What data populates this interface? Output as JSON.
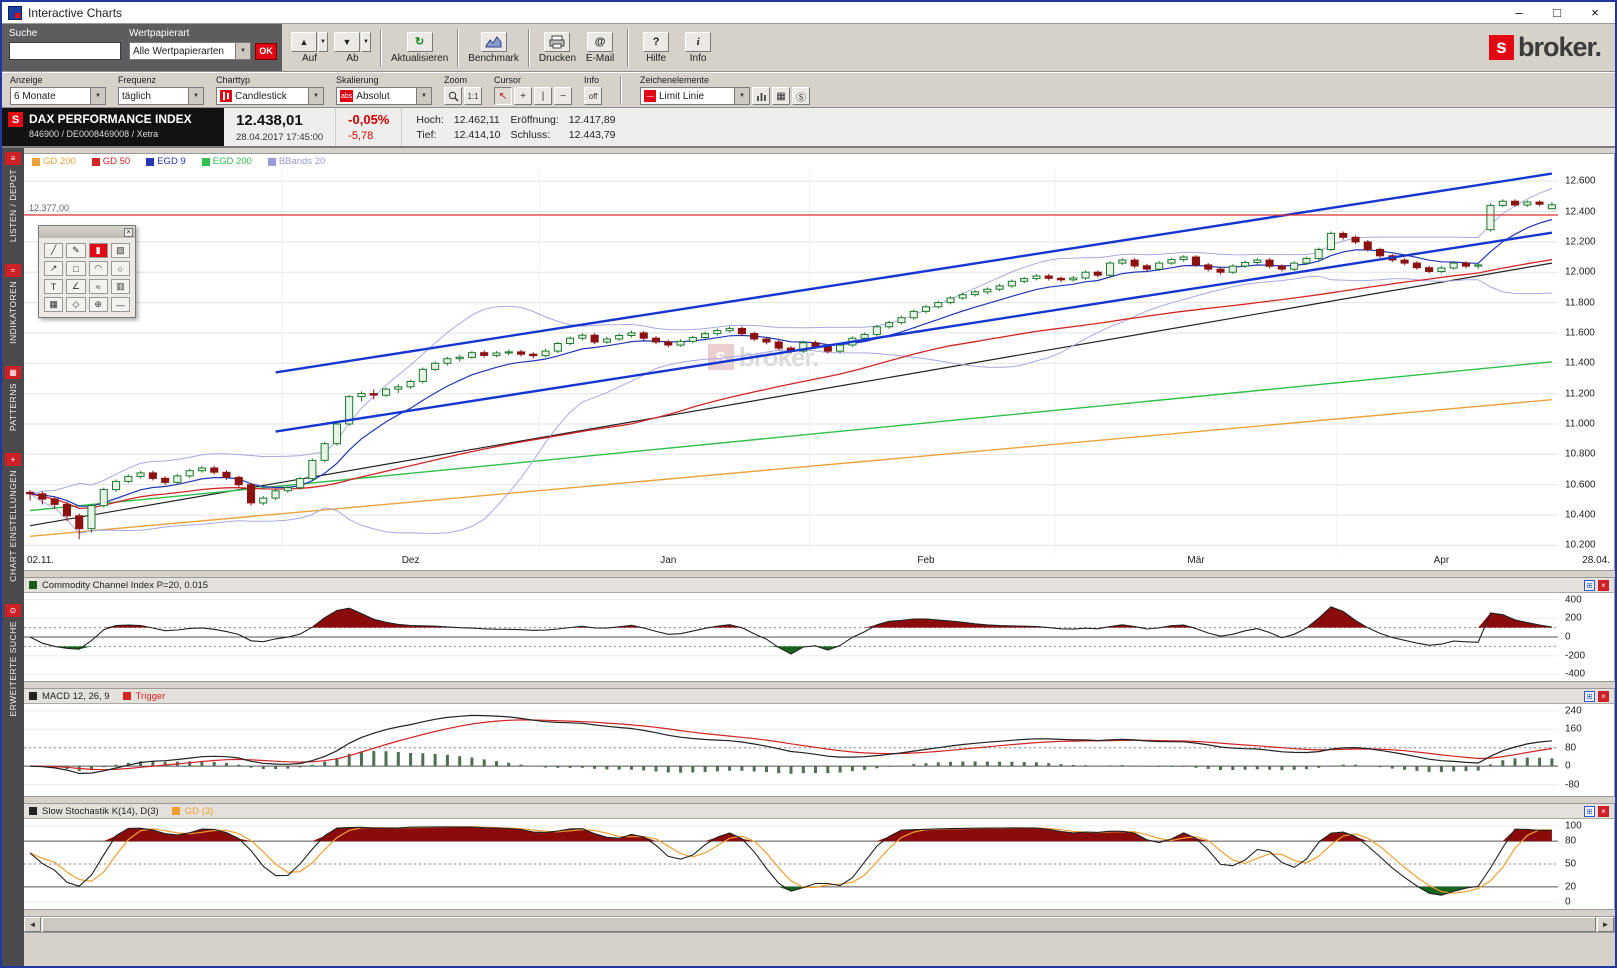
{
  "window": {
    "title": "Interactive Charts",
    "minimize": "–",
    "maximize": "□",
    "close": "×"
  },
  "search_panel": {
    "suche_label": "Suche",
    "search_value": "",
    "wertpapierart_label": "Wertpapierart",
    "wertpapierart_value": "Alle Wertpapierarten",
    "ok_label": "OK"
  },
  "toolbar": {
    "buttons": [
      {
        "label": "Auf",
        "glyph": "▲"
      },
      {
        "label": "Ab",
        "glyph": "▼"
      },
      {
        "label": "Aktualisieren",
        "glyph": "↻"
      },
      {
        "label": "Benchmark"
      },
      {
        "label": "Drucken"
      },
      {
        "label": "E-Mail",
        "glyph": "@"
      },
      {
        "label": "Hilfe",
        "glyph": "?"
      },
      {
        "label": "Info",
        "glyph": "i"
      }
    ]
  },
  "brand": {
    "s": "s",
    "name": "broker."
  },
  "controls": {
    "anzeige_label": "Anzeige",
    "anzeige_value": "6 Monate",
    "frequenz_label": "Frequenz",
    "frequenz_value": "täglich",
    "charttyp_label": "Charttyp",
    "charttyp_value": "Candlestick",
    "skalierung_label": "Skalierung",
    "skalierung_badge": "abs",
    "skalierung_value": "Absolut",
    "zoom_label": "Zoom",
    "zoom_ratio": "1:1",
    "cursor_label": "Cursor",
    "cursor_buttons": [
      "↖",
      "+",
      "|",
      "−"
    ],
    "info_label": "Info",
    "info_value": "off",
    "zeichen_label": "Zeichenelemente",
    "zeichen_icon": "—",
    "zeichen_value": "Limit Linie",
    "zeichen_buttons": [
      "▦",
      "Ⓢ"
    ]
  },
  "instrument": {
    "name": "DAX PERFORMANCE INDEX",
    "icon": "S",
    "id_line": "846900 / DE0008469008 / Xetra",
    "price": "12.438,01",
    "datetime": "28.04.2017 17:45:00",
    "change_pct": "-0,05%",
    "change_abs": "-5,78",
    "hoch_label": "Hoch:",
    "hoch": "12.462,11",
    "eroeffnung_label": "Eröffnung:",
    "eroeffnung": "12.417,89",
    "tief_label": "Tief:",
    "tief": "12.414,10",
    "schluss_label": "Schluss:",
    "schluss": "12.443,79"
  },
  "sidebar": {
    "items": [
      {
        "label": "LISTEN / DEPOT",
        "icon": "≡"
      },
      {
        "label": "INDIKATOREN",
        "icon": "≈"
      },
      {
        "label": "PATTERNS",
        "icon": "▦"
      },
      {
        "label": "CHART EINSTELLUNGEN",
        "icon": "+"
      },
      {
        "label": "ERWEITERTE SUCHE",
        "icon": "⊙"
      }
    ]
  },
  "legend": {
    "items": [
      {
        "label": "GD 200",
        "color": "#e8a33d"
      },
      {
        "label": "GD 50",
        "color": "#d42424"
      },
      {
        "label": "EGD 9",
        "color": "#2336b9"
      },
      {
        "label": "EGD 200",
        "color": "#2fbf4a"
      },
      {
        "label": "BBands 20",
        "color": "#9a9ade"
      }
    ]
  },
  "palette": {
    "tools": [
      "╱",
      "✎",
      "▮",
      "▨",
      "↗",
      "□",
      "◠",
      "○",
      "T",
      "∠",
      "≈",
      "▥",
      "▦",
      "◇",
      "⊕",
      "—"
    ],
    "close": "×"
  },
  "watermark": {
    "s": "s",
    "text": "broker."
  },
  "chart_data": {
    "type": "candlestick",
    "main": {
      "ylim": [
        10150,
        12680
      ],
      "yticks": [
        12600,
        12400,
        12200,
        12000,
        11800,
        11600,
        11400,
        11200,
        11000,
        10800,
        10600,
        10400,
        10200
      ],
      "x_ticks": [
        {
          "pos": 0,
          "label": "02.11.",
          "align": "start"
        },
        {
          "pos": 31,
          "label": "Dez"
        },
        {
          "pos": 52,
          "label": "Jan"
        },
        {
          "pos": 73,
          "label": "Feb"
        },
        {
          "pos": 95,
          "label": "Mär"
        },
        {
          "pos": 115,
          "label": "Apr"
        },
        {
          "pos": 124,
          "label": "28.04.",
          "align": "end"
        }
      ],
      "month_starts": [
        21,
        42,
        64,
        84,
        107
      ],
      "up_color": "#1b7a2a",
      "up_fill": "#e9f4e9",
      "down_color": "#8c1212",
      "gd50_color": "#d42424",
      "egd9_color": "#2336b9",
      "bband_color": "#a9a9e2",
      "lines": [
        {
          "name": "trendline",
          "i1": 0,
          "v1": 10330,
          "i2": 124,
          "v2": 12060,
          "color": "#222222",
          "width": 1.2
        },
        {
          "name": "gd200",
          "i1": 0,
          "v1": 10260,
          "i2": 124,
          "v2": 11160,
          "color": "#e8a33d",
          "width": 1.4
        },
        {
          "name": "egd200",
          "i1": 0,
          "v1": 10430,
          "i2": 124,
          "v2": 11410,
          "color": "#2fbf4a",
          "width": 1.4
        }
      ],
      "channel": [
        {
          "i1": 20,
          "v1": 11340,
          "i2": 124,
          "v2": 12650,
          "color": "#1536d0",
          "width": 2.4
        },
        {
          "i1": 20,
          "v1": 10950,
          "i2": 124,
          "v2": 12260,
          "color": "#1536d0",
          "width": 2.4
        }
      ],
      "limit": {
        "value": 12377,
        "label": "12.377,00",
        "color": "#e03030"
      },
      "candles": [
        [
          10550,
          10565,
          10495,
          10540
        ],
        [
          10540,
          10555,
          10470,
          10505
        ],
        [
          10505,
          10520,
          10440,
          10470
        ],
        [
          10470,
          10488,
          10360,
          10395
        ],
        [
          10395,
          10410,
          10240,
          10310
        ],
        [
          10310,
          10475,
          10285,
          10462
        ],
        [
          10462,
          10580,
          10450,
          10568
        ],
        [
          10568,
          10635,
          10555,
          10622
        ],
        [
          10622,
          10668,
          10610,
          10655
        ],
        [
          10655,
          10690,
          10640,
          10678
        ],
        [
          10678,
          10692,
          10628,
          10642
        ],
        [
          10642,
          10655,
          10598,
          10615
        ],
        [
          10615,
          10670,
          10602,
          10658
        ],
        [
          10658,
          10705,
          10645,
          10692
        ],
        [
          10692,
          10722,
          10680,
          10710
        ],
        [
          10710,
          10724,
          10668,
          10682
        ],
        [
          10682,
          10695,
          10632,
          10648
        ],
        [
          10648,
          10660,
          10585,
          10600
        ],
        [
          10600,
          10612,
          10462,
          10480
        ],
        [
          10480,
          10525,
          10465,
          10512
        ],
        [
          10512,
          10572,
          10498,
          10560
        ],
        [
          10560,
          10592,
          10545,
          10580
        ],
        [
          10580,
          10652,
          10566,
          10640
        ],
        [
          10640,
          10772,
          10628,
          10760
        ],
        [
          10760,
          10882,
          10748,
          10870
        ],
        [
          10870,
          11012,
          10858,
          11000
        ],
        [
          11000,
          11192,
          10988,
          11180
        ],
        [
          11180,
          11215,
          11148,
          11200
        ],
        [
          11200,
          11228,
          11162,
          11190
        ],
        [
          11190,
          11242,
          11178,
          11230
        ],
        [
          11230,
          11262,
          11205,
          11245
        ],
        [
          11245,
          11292,
          11232,
          11280
        ],
        [
          11280,
          11372,
          11268,
          11360
        ],
        [
          11360,
          11412,
          11348,
          11400
        ],
        [
          11400,
          11442,
          11385,
          11430
        ],
        [
          11430,
          11455,
          11412,
          11440
        ],
        [
          11440,
          11482,
          11428,
          11470
        ],
        [
          11470,
          11485,
          11438,
          11452
        ],
        [
          11452,
          11480,
          11440,
          11468
        ],
        [
          11468,
          11490,
          11452,
          11475
        ],
        [
          11475,
          11488,
          11445,
          11460
        ],
        [
          11460,
          11472,
          11432,
          11450
        ],
        [
          11450,
          11495,
          11438,
          11480
        ],
        [
          11480,
          11542,
          11468,
          11530
        ],
        [
          11530,
          11578,
          11518,
          11565
        ],
        [
          11565,
          11598,
          11550,
          11585
        ],
        [
          11585,
          11598,
          11525,
          11540
        ],
        [
          11540,
          11575,
          11528,
          11560
        ],
        [
          11560,
          11596,
          11548,
          11583
        ],
        [
          11583,
          11615,
          11570,
          11600
        ],
        [
          11600,
          11612,
          11550,
          11565
        ],
        [
          11565,
          11578,
          11525,
          11540
        ],
        [
          11540,
          11555,
          11505,
          11520
        ],
        [
          11520,
          11558,
          11508,
          11545
        ],
        [
          11545,
          11582,
          11532,
          11570
        ],
        [
          11570,
          11608,
          11558,
          11595
        ],
        [
          11595,
          11628,
          11582,
          11615
        ],
        [
          11615,
          11642,
          11602,
          11630
        ],
        [
          11630,
          11642,
          11582,
          11596
        ],
        [
          11596,
          11608,
          11546,
          11560
        ],
        [
          11560,
          11572,
          11525,
          11540
        ],
        [
          11540,
          11552,
          11486,
          11500
        ],
        [
          11500,
          11512,
          11465,
          11480
        ],
        [
          11480,
          11548,
          11468,
          11535
        ],
        [
          11535,
          11548,
          11495,
          11510
        ],
        [
          11510,
          11522,
          11465,
          11480
        ],
        [
          11480,
          11532,
          11468,
          11520
        ],
        [
          11520,
          11578,
          11508,
          11565
        ],
        [
          11565,
          11602,
          11552,
          11590
        ],
        [
          11590,
          11652,
          11578,
          11640
        ],
        [
          11640,
          11680,
          11628,
          11668
        ],
        [
          11668,
          11712,
          11655,
          11700
        ],
        [
          11700,
          11755,
          11688,
          11742
        ],
        [
          11742,
          11785,
          11730,
          11772
        ],
        [
          11772,
          11812,
          11760,
          11800
        ],
        [
          11800,
          11842,
          11788,
          11830
        ],
        [
          11830,
          11865,
          11818,
          11852
        ],
        [
          11852,
          11882,
          11840,
          11870
        ],
        [
          11870,
          11900,
          11858,
          11888
        ],
        [
          11888,
          11922,
          11876,
          11910
        ],
        [
          11910,
          11952,
          11898,
          11940
        ],
        [
          11940,
          11970,
          11928,
          11958
        ],
        [
          11958,
          11988,
          11946,
          11975
        ],
        [
          11975,
          11988,
          11945,
          11960
        ],
        [
          11960,
          11972,
          11935,
          11950
        ],
        [
          11950,
          11975,
          11938,
          11962
        ],
        [
          11962,
          12012,
          11950,
          12000
        ],
        [
          12000,
          12012,
          11965,
          11980
        ],
        [
          11980,
          12072,
          11968,
          12060
        ],
        [
          12060,
          12092,
          12048,
          12080
        ],
        [
          12080,
          12092,
          12028,
          12042
        ],
        [
          12042,
          12055,
          12005,
          12020
        ],
        [
          12020,
          12072,
          12008,
          12060
        ],
        [
          12060,
          12095,
          12048,
          12083
        ],
        [
          12083,
          12112,
          12070,
          12100
        ],
        [
          12100,
          12112,
          12035,
          12048
        ],
        [
          12048,
          12060,
          12005,
          12020
        ],
        [
          12020,
          12032,
          11985,
          12000
        ],
        [
          12000,
          12052,
          11988,
          12040
        ],
        [
          12040,
          12076,
          12028,
          12064
        ],
        [
          12064,
          12092,
          12052,
          12080
        ],
        [
          12080,
          12092,
          12026,
          12040
        ],
        [
          12040,
          12052,
          12005,
          12020
        ],
        [
          12020,
          12072,
          12008,
          12060
        ],
        [
          12060,
          12102,
          12048,
          12090
        ],
        [
          12090,
          12162,
          12078,
          12150
        ],
        [
          12150,
          12268,
          12138,
          12256
        ],
        [
          12256,
          12268,
          12215,
          12230
        ],
        [
          12230,
          12242,
          12186,
          12200
        ],
        [
          12200,
          12212,
          12136,
          12150
        ],
        [
          12150,
          12162,
          12095,
          12108
        ],
        [
          12108,
          12120,
          12066,
          12080
        ],
        [
          12080,
          12092,
          12046,
          12060
        ],
        [
          12060,
          12072,
          12016,
          12030
        ],
        [
          12030,
          12042,
          11992,
          12005
        ],
        [
          12005,
          12040,
          11992,
          12028
        ],
        [
          12028,
          12072,
          12016,
          12060
        ],
        [
          12060,
          12072,
          12026,
          12040
        ],
        [
          12040,
          12060,
          12020,
          12048
        ],
        [
          12280,
          12455,
          12268,
          12440
        ],
        [
          12440,
          12480,
          12428,
          12468
        ],
        [
          12468,
          12480,
          12430,
          12443
        ],
        [
          12443,
          12474,
          12430,
          12462
        ],
        [
          12462,
          12474,
          12435,
          12448
        ],
        [
          12418,
          12462,
          12414,
          12444
        ]
      ]
    }
  },
  "panels": {
    "cci": {
      "title": "Commodity Channel Index P=20, 0.015",
      "icon_color": "#1a5c1a",
      "ylim": [
        -470,
        470
      ],
      "yticks": [
        400,
        200,
        0,
        -200,
        -400
      ],
      "levels_solid": [
        0
      ],
      "levels_dotted": [
        100,
        -100
      ],
      "line_color": "#222222",
      "fill_above": {
        "level": 100,
        "color": "#8b0b0b"
      },
      "fill_below": {
        "level": -100,
        "color": "#14641d"
      }
    },
    "macd": {
      "title": "MACD 12, 26, 9",
      "icon_color": "#222222",
      "trigger_label": "Trigger",
      "trigger_color": "#d42424",
      "ylim": [
        -130,
        270
      ],
      "yticks": [
        240,
        160,
        80,
        0,
        -80
      ],
      "levels_solid": [
        0
      ],
      "levels_dotted": [
        80
      ],
      "line_color": "#222222",
      "hist_color": "#4e7050"
    },
    "stoch": {
      "title": "Slow Stochastik K(14), D(3)",
      "icon_color": "#222222",
      "gd_label": "GD (3)",
      "gd_color": "#f0a030",
      "ylim": [
        -9,
        109
      ],
      "yticks": [
        100,
        80,
        50,
        20,
        0
      ],
      "levels_solid": [
        80,
        20
      ],
      "levels_dotted": [
        50
      ],
      "line_color": "#222222",
      "fill_above": {
        "level": 80,
        "color": "#8b0b0b"
      },
      "fill_below": {
        "level": 20,
        "color": "#14641d"
      }
    },
    "close_glyph": "×",
    "gear_glyph": "⊞"
  },
  "scrollbar": {
    "left": "◄",
    "right": "►"
  }
}
